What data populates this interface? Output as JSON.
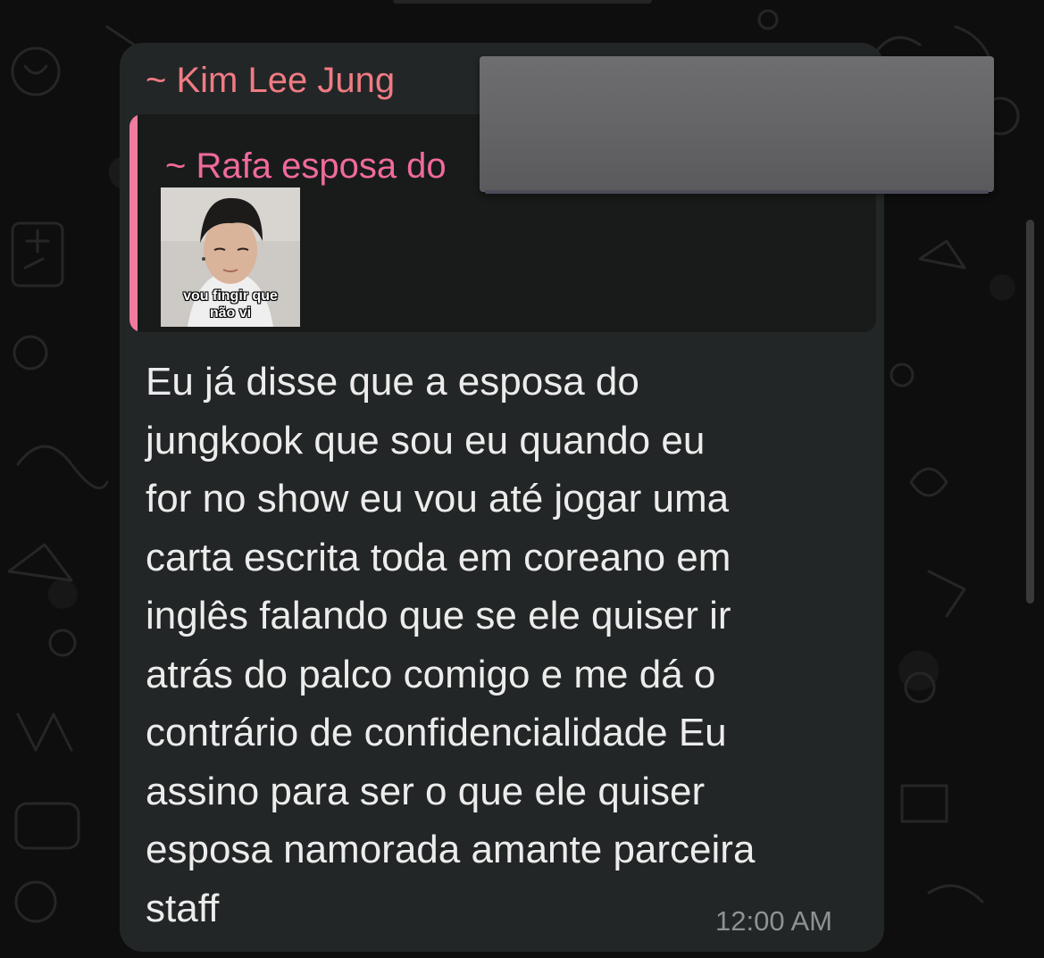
{
  "message": {
    "sender": "~ Kim Lee Jung",
    "quoted": {
      "author": "~ Rafa esposa do",
      "sticker_caption": "vou fingir que\nnão vi"
    },
    "lines": [
      "Eu já disse que a esposa do",
      "jungkook que sou eu quando eu",
      "for no show eu vou até jogar uma",
      "carta escrita toda em coreano em",
      "inglês falando que se ele quiser ir",
      "atrás do palco comigo e me dá o",
      "contrário de confidencialidade Eu",
      "assino para ser o que ele quiser",
      "esposa namorada amante parceira",
      "staff"
    ],
    "time": "12:00 AM"
  },
  "colors": {
    "sender_name": "#f07b84",
    "quoted_author": "#f06a9c",
    "quote_bar": "#f07b9e",
    "bubble": "#232626",
    "message_text": "#ececec",
    "timestamp": "#8e9292",
    "redaction": "#666668"
  }
}
